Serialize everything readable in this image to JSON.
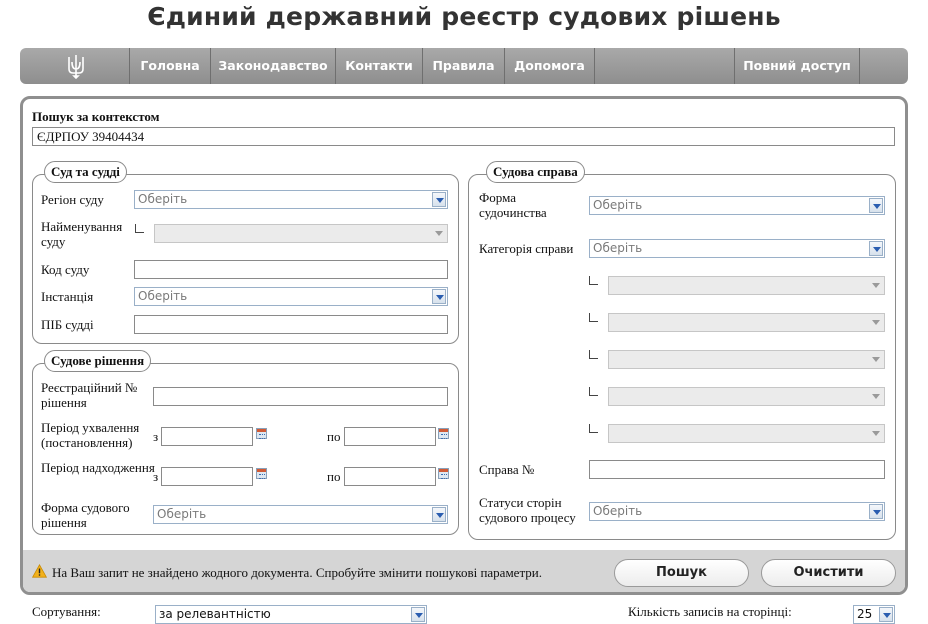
{
  "page_title": "Єдиний державний реєстр судових рішень",
  "nav": {
    "logo_icon": "trident-icon",
    "items": [
      "Головна",
      "Законодавство",
      "Контакти",
      "Правила",
      "Допомога"
    ],
    "full_access": "Повний доступ"
  },
  "search": {
    "label": "Пошук за контекстом",
    "value": "ЄДРПОУ 39404434"
  },
  "court": {
    "legend": "Суд та судді",
    "region_label": "Регіон суду",
    "region_value": "Оберіть",
    "name_label": "Найменування суду",
    "code_label": "Код суду",
    "instance_label": "Інстанція",
    "instance_value": "Оберіть",
    "judge_label": "ПІБ судді"
  },
  "decision": {
    "legend": "Судове рішення",
    "reg_label": "Реєстраційний № рішення",
    "adopt_label": "Період ухвалення (постановлення)",
    "receipt_label": "Період надходження",
    "from": "з",
    "to": "по",
    "form_label": "Форма судового рішення",
    "form_value": "Оберіть"
  },
  "case": {
    "legend": "Судова справа",
    "proc_label": "Форма судочинства",
    "proc_value": "Оберіть",
    "category_label": "Категорія справи",
    "category_value": "Оберіть",
    "case_no_label": "Справа №",
    "status_label": "Статуси сторін судового процесу",
    "status_value": "Оберіть"
  },
  "footer": {
    "warning_icon": "warning-icon",
    "message": "На Ваш запит не знайдено жодного документа. Спробуйте змінити пошукові параметри.",
    "search_button": "Пошук",
    "clear_button": "Очистити"
  },
  "bottom": {
    "sort_label": "Сортування:",
    "sort_value": "за релевантністю",
    "per_page_label": "Кількість записів на сторінці:",
    "per_page_value": "25"
  }
}
